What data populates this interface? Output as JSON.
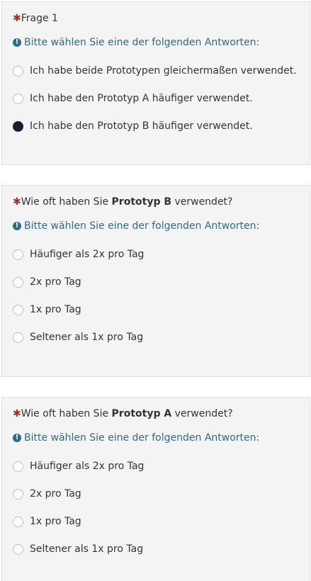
{
  "questions": [
    {
      "title_prefix": "Frage 1",
      "title_bold": "",
      "title_suffix": "",
      "help": "Bitte wählen Sie eine der folgenden Antworten:",
      "options": [
        "Ich habe beide Prototypen gleichermaßen verwendet.",
        "Ich habe den Prototyp A häufiger verwendet.",
        "Ich habe den Prototyp B häufiger verwendet."
      ],
      "selected_index": 2
    },
    {
      "title_prefix": "Wie oft haben Sie ",
      "title_bold": "Prototyp B",
      "title_suffix": " verwendet?",
      "help": "Bitte wählen Sie eine der folgenden Antworten:",
      "options": [
        "Häufiger als 2x pro Tag",
        "2x pro Tag",
        "1x pro Tag",
        "Seltener als 1x pro Tag"
      ],
      "selected_index": -1
    },
    {
      "title_prefix": "Wie oft haben Sie ",
      "title_bold": "Prototyp A",
      "title_suffix": " verwendet?",
      "help": "Bitte wählen Sie eine der folgenden Antworten:",
      "options": [
        "Häufiger als 2x pro Tag",
        "2x pro Tag",
        "1x pro Tag",
        "Seltener als 1x pro Tag"
      ],
      "selected_index": -1
    }
  ],
  "required_marker": "✱",
  "help_icon": "info-circle-icon",
  "colors": {
    "required": "#a52f2f",
    "help_text": "#2e6b8a",
    "selected_radio": "#15202c",
    "card_background": "#f4f4f4"
  }
}
